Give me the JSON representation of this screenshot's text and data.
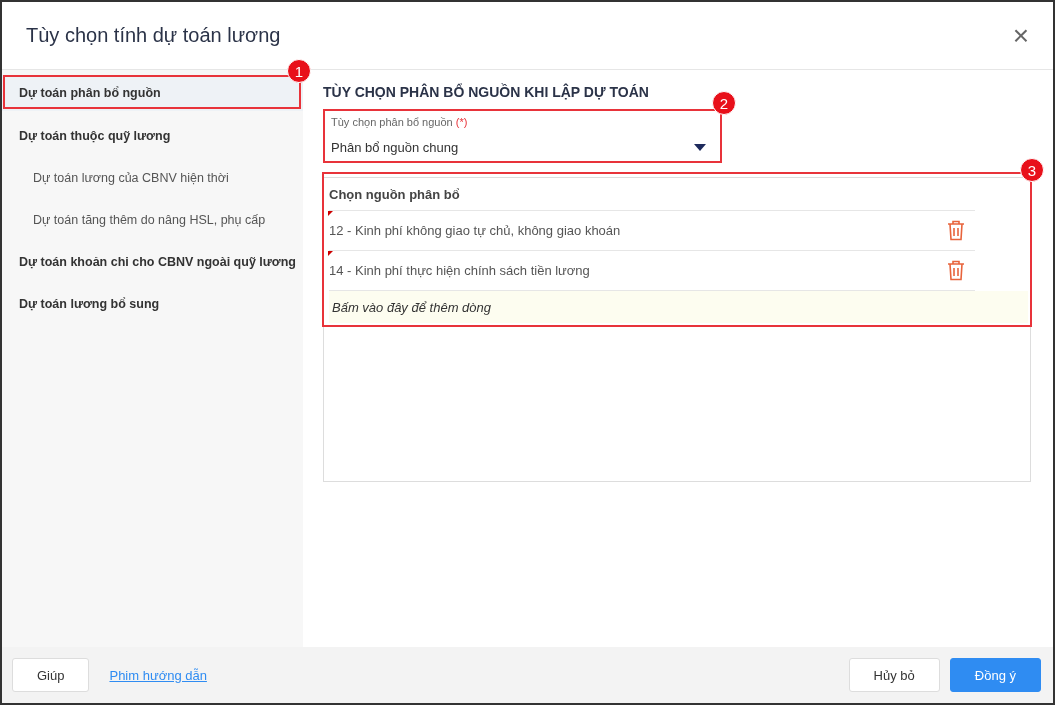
{
  "window": {
    "title": "Tùy chọn tính dự toán lương",
    "close": "×"
  },
  "sidebar": {
    "callout": "1",
    "items": [
      {
        "label": "Dự toán phân bổ nguồn",
        "selected": true
      },
      {
        "label": "Dự toán thuộc quỹ lương",
        "selected": false,
        "children": [
          {
            "label": "Dự toán lương của CBNV hiện thời",
            "selected": false
          },
          {
            "label": "Dự toán tăng thêm do nâng HSL, phụ cấp",
            "selected": false
          }
        ]
      },
      {
        "label": "Dự toán khoản chi cho CBNV ngoài quỹ lương",
        "selected": false
      },
      {
        "label": "Dự toán lương bổ sung",
        "selected": false
      }
    ]
  },
  "section_title": "TÙY CHỌN PHÂN BỔ NGUỒN KHI LẬP DỰ TOÁN",
  "dropdown": {
    "callout": "2",
    "label": "Tùy chọn phân bổ nguồn",
    "required": "(*)",
    "value": "Phân bổ nguồn chung"
  },
  "sources": {
    "callout": "3",
    "header": "Chọn nguồn phân bổ",
    "rows": [
      {
        "text": "12 - Kinh phí không giao tự chủ, không giao khoán"
      },
      {
        "text": "14 - Kinh phí thực hiện chính sách tiền lương"
      }
    ],
    "add_row": "Bấm vào đây để thêm dòng"
  },
  "footer": {
    "help": "Giúp",
    "guide_link": "Phim hướng dẫn",
    "cancel": "Hủy bỏ",
    "ok": "Đồng ý"
  }
}
